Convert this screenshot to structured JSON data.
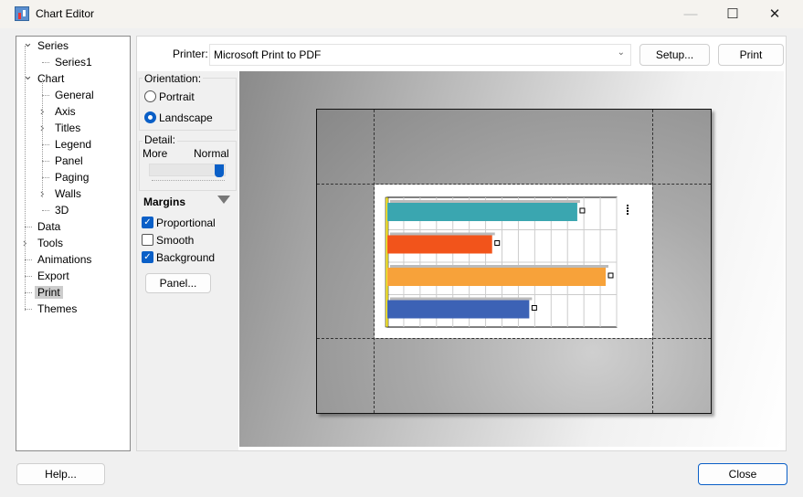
{
  "window": {
    "title": "Chart Editor",
    "minimize": "—",
    "maximize": "☐",
    "close": "✕"
  },
  "tree": [
    {
      "label": "Series",
      "level": 0,
      "toggle": "expanded"
    },
    {
      "label": "Series1",
      "level": 1
    },
    {
      "label": "Chart",
      "level": 0,
      "toggle": "expanded"
    },
    {
      "label": "General",
      "level": 1
    },
    {
      "label": "Axis",
      "level": 1,
      "toggle": "collapsed"
    },
    {
      "label": "Titles",
      "level": 1,
      "toggle": "collapsed"
    },
    {
      "label": "Legend",
      "level": 1
    },
    {
      "label": "Panel",
      "level": 1
    },
    {
      "label": "Paging",
      "level": 1
    },
    {
      "label": "Walls",
      "level": 1,
      "toggle": "collapsed"
    },
    {
      "label": "3D",
      "level": 1
    },
    {
      "label": "Data",
      "level": 0
    },
    {
      "label": "Tools",
      "level": 0,
      "toggle": "collapsed"
    },
    {
      "label": "Animations",
      "level": 0
    },
    {
      "label": "Export",
      "level": 0
    },
    {
      "label": "Print",
      "level": 0,
      "selected": true
    },
    {
      "label": "Themes",
      "level": 0
    }
  ],
  "printer": {
    "label": "Printer:",
    "value": "Microsoft Print to PDF",
    "setup": "Setup...",
    "print": "Print"
  },
  "orientation": {
    "label": "Orientation:",
    "portrait": "Portrait",
    "landscape": "Landscape",
    "selected": "Landscape"
  },
  "detail": {
    "label": "Detail:",
    "more": "More",
    "normal": "Normal",
    "level": 1.0
  },
  "margins": {
    "label": "Margins",
    "proportional": {
      "label": "Proportional",
      "checked": true
    },
    "smooth": {
      "label": "Smooth",
      "checked": false
    },
    "background": {
      "label": "Background",
      "checked": true
    },
    "panel_button": "Panel..."
  },
  "preview_bars": [
    {
      "color": "#3aa6b0",
      "relative_value": 0.87
    },
    {
      "color": "#f2541b",
      "relative_value": 0.48
    },
    {
      "color": "#f7a23a",
      "relative_value": 1.0
    },
    {
      "color": "#3c62b5",
      "relative_value": 0.65
    }
  ],
  "footer": {
    "help": "Help...",
    "close": "Close"
  },
  "colors": {
    "accent": "#0a5fc7"
  }
}
